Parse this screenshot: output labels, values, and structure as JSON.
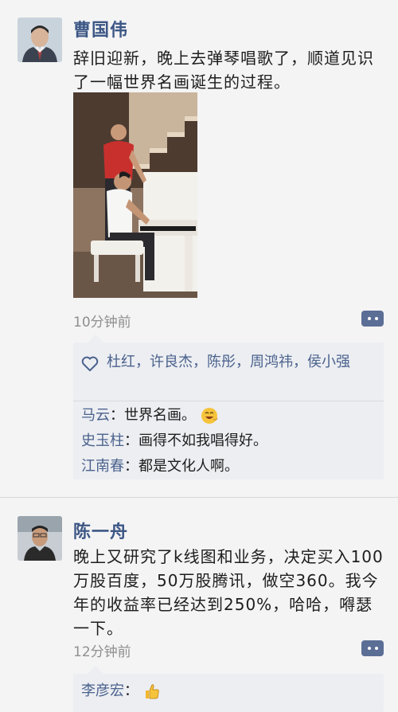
{
  "posts": [
    {
      "author": "曹国伟",
      "content": "辞旧迎新，晚上去弹琴唱歌了，顺道见识了一幅世界名画诞生的过程。",
      "time": "10分钟前",
      "likes": "杜红，许良杰，陈彤，周鸿祎，侯小强",
      "comments": [
        {
          "name": "马云",
          "text": "世界名画。",
          "emoji": "laughing-face-icon"
        },
        {
          "name": "史玉柱",
          "text": "画得不如我唱得好。"
        },
        {
          "name": "江南春",
          "text": "都是文化人啊。"
        }
      ]
    },
    {
      "author": "陈一舟",
      "content": "晚上又研究了k线图和业务，决定买入100万股百度，50万股腾讯，做空360。我今年的收益率已经达到250%，哈哈，嘚瑟一下。",
      "time": "12分钟前",
      "comments": [
        {
          "name": "李彦宏",
          "text": "",
          "emoji": "thumbs-up-icon"
        }
      ]
    }
  ],
  "colors": {
    "link": "#4b628d",
    "name": "#3d5785",
    "panel": "#eceef2",
    "more_button": "#5b6e96"
  }
}
